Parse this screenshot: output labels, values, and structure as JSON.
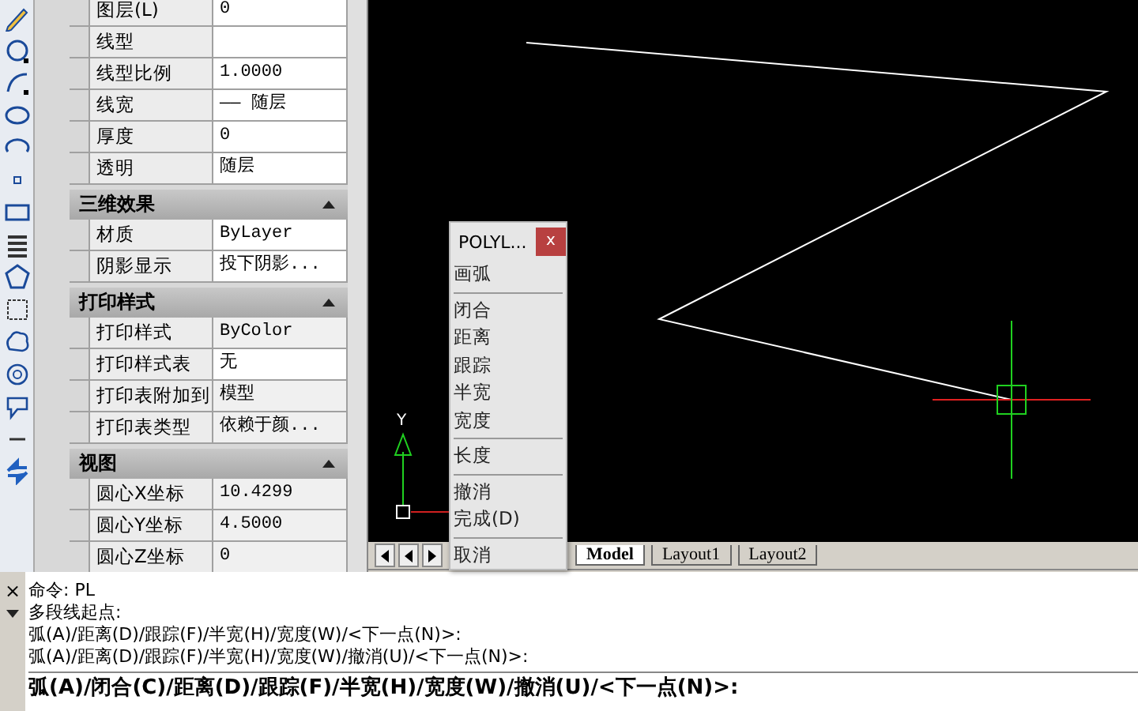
{
  "properties": {
    "sections": [
      {
        "rows": [
          {
            "name": "图层(L)",
            "value": "0",
            "editable": true
          },
          {
            "name": "线型",
            "value": "",
            "editable": true
          },
          {
            "name": "线型比例",
            "value": "1.0000",
            "editable": true
          },
          {
            "name": "线宽",
            "value": "—— 随层",
            "editable": true
          },
          {
            "name": "厚度",
            "value": "0",
            "editable": true
          },
          {
            "name": "透明",
            "value": "随层",
            "editable": true
          }
        ]
      },
      {
        "title": "三维效果",
        "expanded": true,
        "rows": [
          {
            "name": "材质",
            "value": "ByLayer",
            "editable": true
          },
          {
            "name": "阴影显示",
            "value": "投下阴影...",
            "editable": true
          }
        ]
      },
      {
        "title": "打印样式",
        "expanded": true,
        "rows": [
          {
            "name": "打印样式",
            "value": "ByColor",
            "editable": false
          },
          {
            "name": "打印样式表",
            "value": "无",
            "editable": true
          },
          {
            "name": "打印表附加到",
            "value": "模型",
            "editable": false
          },
          {
            "name": "打印表类型",
            "value": "依赖于颜...",
            "editable": false
          }
        ]
      },
      {
        "title": "视图",
        "expanded": true,
        "rows": [
          {
            "name": "圆心X坐标",
            "value": "10.4299",
            "editable": false
          },
          {
            "name": "圆心Y坐标",
            "value": "4.5000",
            "editable": false
          },
          {
            "name": "圆心Z坐标",
            "value": "0",
            "editable": false
          }
        ]
      }
    ]
  },
  "canvas": {
    "axis_label": "Y"
  },
  "layout_tabs": [
    {
      "label": "Model",
      "selected": true
    },
    {
      "label": "Layout1",
      "selected": false
    },
    {
      "label": "Layout2",
      "selected": false
    }
  ],
  "popup_menu": {
    "title": "POLYL...",
    "close": "x",
    "groups": [
      [
        "画弧"
      ],
      [
        "闭合",
        "距离",
        "跟踪",
        "半宽",
        "宽度"
      ],
      [
        "长度"
      ],
      [
        "撤消",
        "完成(D)"
      ],
      [
        "取消"
      ]
    ]
  },
  "command_window": {
    "close": "×",
    "lines": [
      "命令:  PL",
      "多段线起点:",
      "弧(A)/距离(D)/跟踪(F)/半宽(H)/宽度(W)/<下一点(N)>:",
      "弧(A)/距离(D)/跟踪(F)/半宽(H)/宽度(W)/撤消(U)/<下一点(N)>:"
    ],
    "prompt": "弧(A)/闭合(C)/距离(D)/跟踪(F)/半宽(H)/宽度(W)/撤消(U)/<下一点(N)>:"
  }
}
